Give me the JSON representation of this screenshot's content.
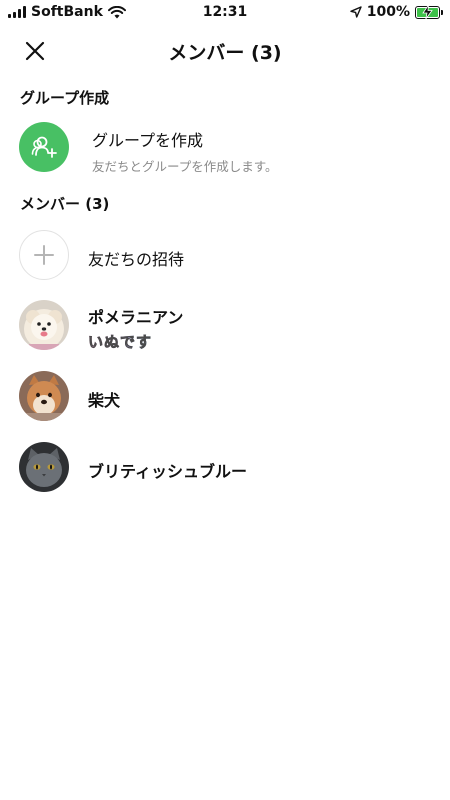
{
  "status_bar": {
    "carrier": "SoftBank",
    "time": "12:31",
    "battery": "100%"
  },
  "header": {
    "title": "メンバー (3)",
    "close_icon": "close-icon"
  },
  "sections": {
    "group_create_label": "グループ作成",
    "members_label": "メンバー (3)"
  },
  "create_group": {
    "title": "グループを作成",
    "subtitle": "友だちとグループを作成します。",
    "icon": "add-people-icon",
    "accent": "#48c064"
  },
  "invite": {
    "label": "友だちの招待",
    "icon": "plus-icon"
  },
  "members": [
    {
      "name": "ポメラニアン",
      "status_message": "いぬです",
      "avatar": "pomeranian-avatar"
    },
    {
      "name": "柴犬",
      "avatar": "shiba-avatar"
    },
    {
      "name": "ブリティッシュブルー",
      "avatar": "british-blue-cat-avatar"
    }
  ]
}
